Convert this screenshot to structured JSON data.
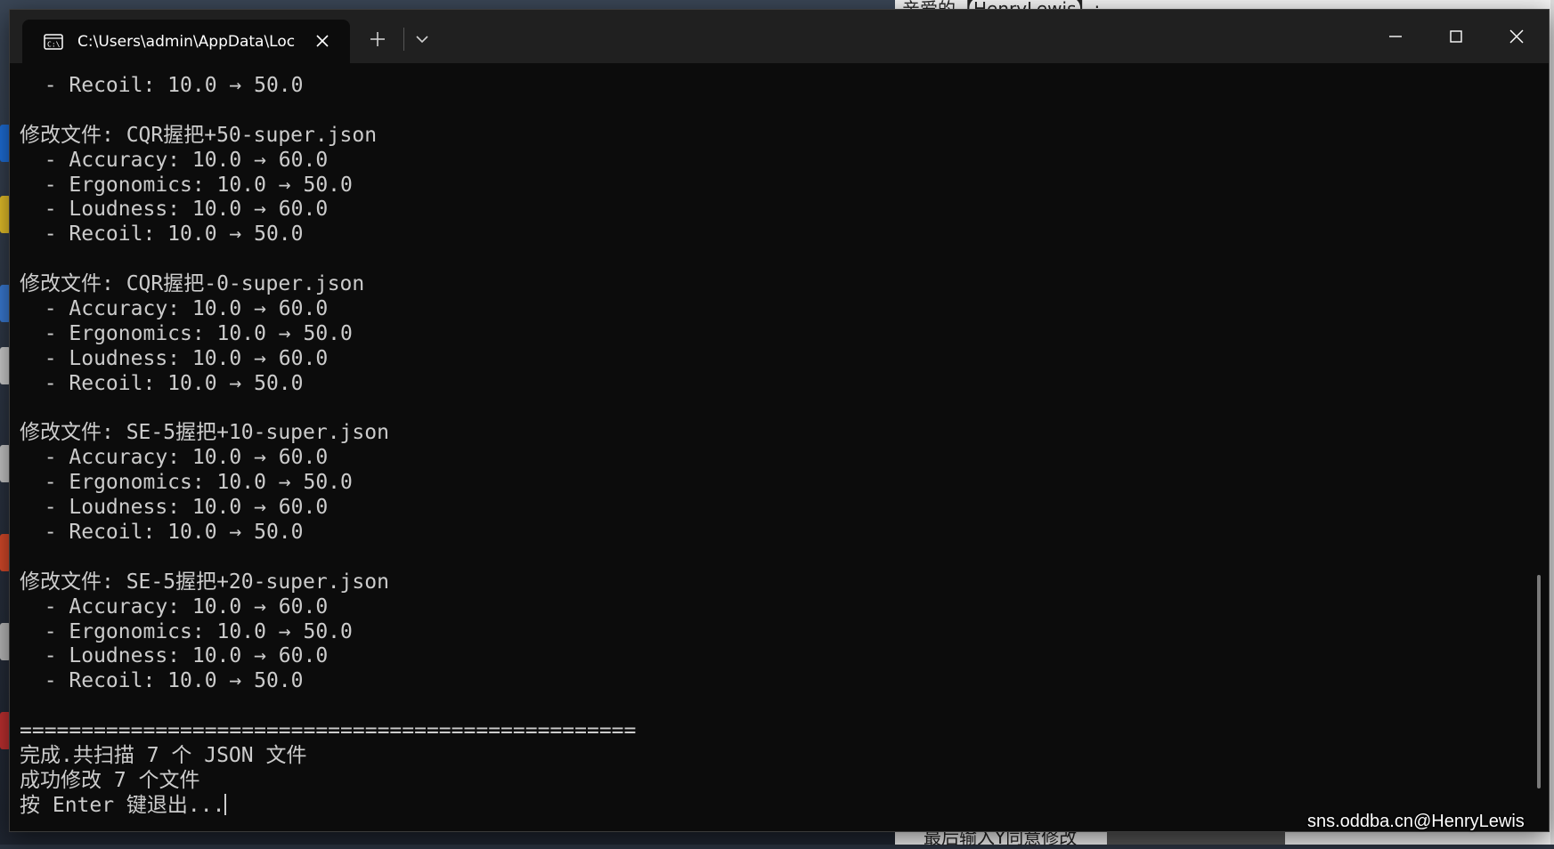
{
  "window": {
    "tab_title": "C:\\Users\\admin\\AppData\\Loc",
    "tab_icon": "terminal-icon",
    "controls": [
      "new-tab-icon",
      "chevron-down-icon",
      "minimize-icon",
      "maximize-icon",
      "close-icon"
    ]
  },
  "console": {
    "lines": [
      "  - Recoil: 10.0 → 50.0",
      "",
      "修改文件: CQR握把+50-super.json",
      "  - Accuracy: 10.0 → 60.0",
      "  - Ergonomics: 10.0 → 50.0",
      "  - Loudness: 10.0 → 60.0",
      "  - Recoil: 10.0 → 50.0",
      "",
      "修改文件: CQR握把-0-super.json",
      "  - Accuracy: 10.0 → 60.0",
      "  - Ergonomics: 10.0 → 50.0",
      "  - Loudness: 10.0 → 60.0",
      "  - Recoil: 10.0 → 50.0",
      "",
      "修改文件: SE-5握把+10-super.json",
      "  - Accuracy: 10.0 → 60.0",
      "  - Ergonomics: 10.0 → 50.0",
      "  - Loudness: 10.0 → 60.0",
      "  - Recoil: 10.0 → 50.0",
      "",
      "修改文件: SE-5握把+20-super.json",
      "  - Accuracy: 10.0 → 60.0",
      "  - Ergonomics: 10.0 → 50.0",
      "  - Loudness: 10.0 → 60.0",
      "  - Recoil: 10.0 → 50.0",
      "",
      "==================================================",
      "完成.共扫描 7 个 JSON 文件",
      "成功修改 7 个文件",
      "按 Enter 键退出..."
    ]
  },
  "background": {
    "top_text": "亲爱的【HenryLewis】:",
    "bottom_text": "最后输入Y同意修改"
  },
  "watermark": "sns.oddba.cn@HenryLewis",
  "colors": {
    "console_bg": "#0c0c0c",
    "console_fg": "#cccccc",
    "titlebar": "#202020"
  }
}
